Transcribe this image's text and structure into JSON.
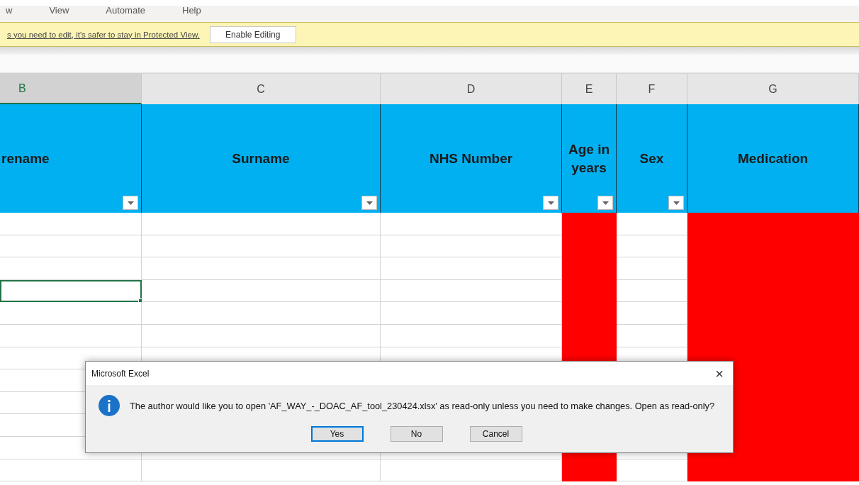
{
  "menu": [
    {
      "label": "w"
    },
    {
      "label": "View"
    },
    {
      "label": "Automate"
    },
    {
      "label": "Help"
    }
  ],
  "protected_bar": {
    "message": "s you need to edit, it's safer to stay in Protected View.",
    "button": "Enable Editing"
  },
  "sheet": {
    "columns": [
      {
        "letter": "B",
        "heading": "rename",
        "selected": true,
        "color": "#ffffff"
      },
      {
        "letter": "C",
        "heading": "Surname",
        "selected": false,
        "color": "#ffffff"
      },
      {
        "letter": "D",
        "heading": "NHS Number",
        "selected": false,
        "color": "#ffffff"
      },
      {
        "letter": "E",
        "heading": "Age in years",
        "selected": false,
        "color": "#ff0000"
      },
      {
        "letter": "F",
        "heading": "Sex",
        "selected": false,
        "color": "#ffffff"
      },
      {
        "letter": "G",
        "heading": "Medication",
        "selected": false,
        "color": "#ff0000"
      }
    ],
    "rows": [
      {
        "selected": false
      },
      {
        "selected": false
      },
      {
        "selected": false
      },
      {
        "selected": true
      },
      {
        "selected": false
      },
      {
        "selected": false
      },
      {
        "selected": false
      },
      {
        "selected": false
      },
      {
        "selected": false
      },
      {
        "selected": false
      },
      {
        "selected": false
      },
      {
        "selected": false
      }
    ]
  },
  "dialog": {
    "title": "Microsoft Excel",
    "message": "The author would like you to open 'AF_WAY_-_DOAC_AF_tool_230424.xlsx' as read-only unless you need to make changes. Open as read-only?",
    "close": "×",
    "buttons": [
      {
        "label": "Yes",
        "selected": true
      },
      {
        "label": "No",
        "selected": false
      },
      {
        "label": "Cancel",
        "selected": false
      }
    ]
  }
}
